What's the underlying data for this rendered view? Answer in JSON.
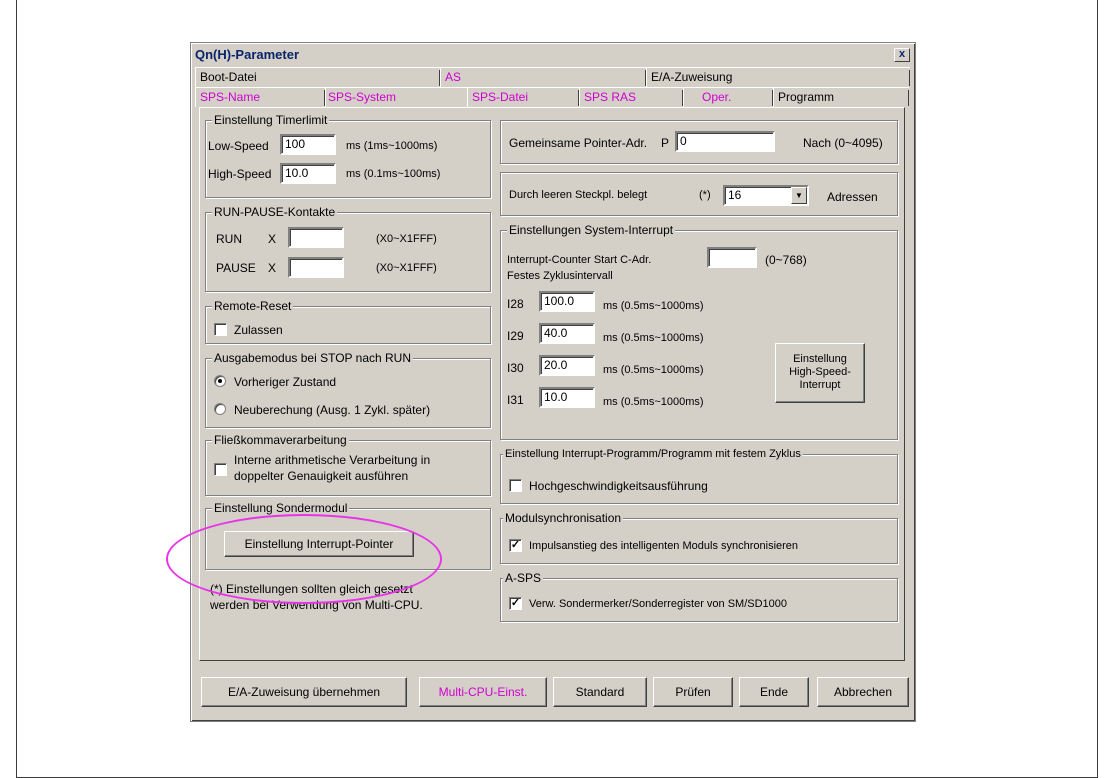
{
  "dialog": {
    "title": "Qn(H)-Parameter",
    "close_label": "x"
  },
  "tabs_row1": [
    "Boot-Datei",
    "AS",
    "E/A-Zuweisung"
  ],
  "tabs_row2": [
    "SPS-Name",
    "SPS-System",
    "SPS-Datei",
    "SPS RAS",
    "Oper.",
    "Programm"
  ],
  "timer": {
    "title": "Einstellung Timerlimit",
    "low_label": "Low-Speed",
    "low_value": "100",
    "low_unit": "ms  (1ms~1000ms)",
    "high_label": "High-Speed",
    "high_value": "10.0",
    "high_unit": "ms  (0.1ms~100ms)"
  },
  "runpause": {
    "title": "RUN-PAUSE-Kontakte",
    "run_label": "RUN",
    "pause_label": "PAUSE",
    "x": "X",
    "run_value": "",
    "pause_value": "",
    "range": "(X0~X1FFF)"
  },
  "remote": {
    "title": "Remote-Reset",
    "allow_label": "Zulassen",
    "checked": false
  },
  "output": {
    "title": "Ausgabemodus bei STOP nach RUN",
    "opt1": "Vorheriger Zustand",
    "opt2": "Neuberechung (Ausg. 1 Zykl. später)",
    "selected": 1
  },
  "float": {
    "title": "Fließkommaverarbeitung",
    "line1": "Interne arithmetische Verarbeitung in",
    "line2": "doppelter Genauigkeit ausführen",
    "checked": false
  },
  "special": {
    "title": "Einstellung Sondermodul",
    "button": "Einstellung Interrupt-Pointer"
  },
  "note": {
    "line1": "(*) Einstellungen sollten gleich gesetzt",
    "line2": "werden bei Verwendung von Multi-CPU."
  },
  "pointer": {
    "label": "Gemeinsame Pointer-Adr.",
    "p": "P",
    "value": "0",
    "suffix": "Nach  (0~4095)"
  },
  "slot": {
    "label": "Durch leeren Steckpl. belegt",
    "star": "(*)",
    "value": "16",
    "suffix": "Adressen"
  },
  "interrupt": {
    "title": "Einstellungen System-Interrupt",
    "counter_label": "Interrupt-Counter Start C-Adr.",
    "counter_value": "",
    "counter_range": "(0~768)",
    "fixed_label": "Festes Zyklusintervall",
    "rows": [
      {
        "name": "I28",
        "value": "100.0",
        "unit": "ms  (0.5ms~1000ms)"
      },
      {
        "name": "I29",
        "value": "40.0",
        "unit": "ms  (0.5ms~1000ms)"
      },
      {
        "name": "I30",
        "value": "20.0",
        "unit": "ms  (0.5ms~1000ms)"
      },
      {
        "name": "I31",
        "value": "10.0",
        "unit": "ms  (0.5ms~1000ms)"
      }
    ],
    "hs_line1": "Einstellung",
    "hs_line2": "High-Speed-",
    "hs_line3": "Interrupt"
  },
  "intprog": {
    "title": "Einstellung Interrupt-Programm/Programm mit festem Zyklus",
    "label": "Hochgeschwindigkeitsausführung",
    "checked": false
  },
  "modsync": {
    "title": "Modulsynchronisation",
    "label": "Impulsanstieg des intelligenten Moduls synchronisieren",
    "checked": true
  },
  "asps": {
    "title": "A-SPS",
    "label": "Verw. Sondermerker/Sonderregister von SM/SD1000",
    "checked": true
  },
  "bottom": {
    "ea": "E/A-Zuweisung übernehmen",
    "multi": "Multi-CPU-Einst.",
    "standard": "Standard",
    "check": "Prüfen",
    "end": "Ende",
    "cancel": "Abbrechen"
  },
  "colors": {
    "dialog_bg": "#d4d0c8",
    "accent_magenta": "#d000d0",
    "annotation": "#e834e8"
  }
}
